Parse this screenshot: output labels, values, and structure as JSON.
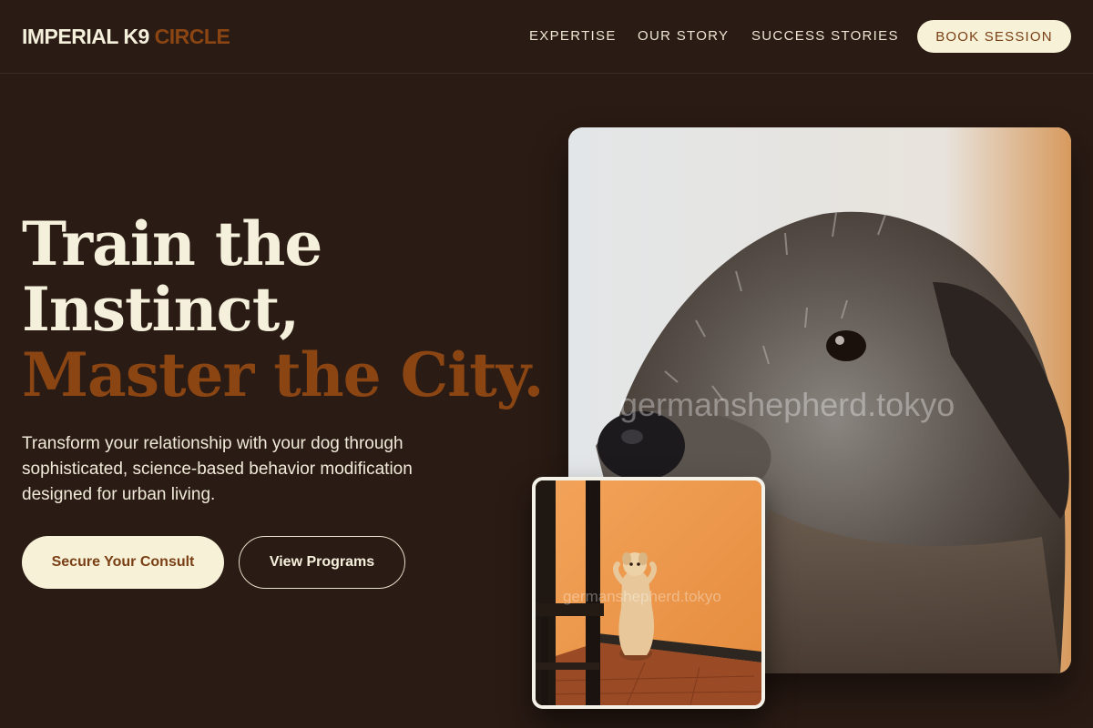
{
  "brand": {
    "name": "IMPERIAL K9",
    "accent": "CIRCLE",
    "accent_color": "#8b4513"
  },
  "nav": {
    "links": [
      "EXPERTISE",
      "OUR STORY",
      "SUCCESS STORIES"
    ],
    "cta": "BOOK SESSION"
  },
  "hero": {
    "headline_line1": "Train the",
    "headline_line2": "Instinct,",
    "headline_line3": "Master the City.",
    "subtext": "Transform your relationship with your dog through sophisticated, science-based behavior modification designed for urban living.",
    "primary_cta": "Secure Your Consult",
    "secondary_cta": "View Programs"
  },
  "images": {
    "main": {
      "subject": "wolfhound-portrait",
      "watermark": "germanshepherd.tokyo"
    },
    "inset": {
      "subject": "dog-begging-orange-wall",
      "watermark": "germanshepherd.tokyo"
    }
  },
  "colors": {
    "background": "#2a1b14",
    "cream": "#f6f1d7",
    "brown": "#8b4513"
  }
}
